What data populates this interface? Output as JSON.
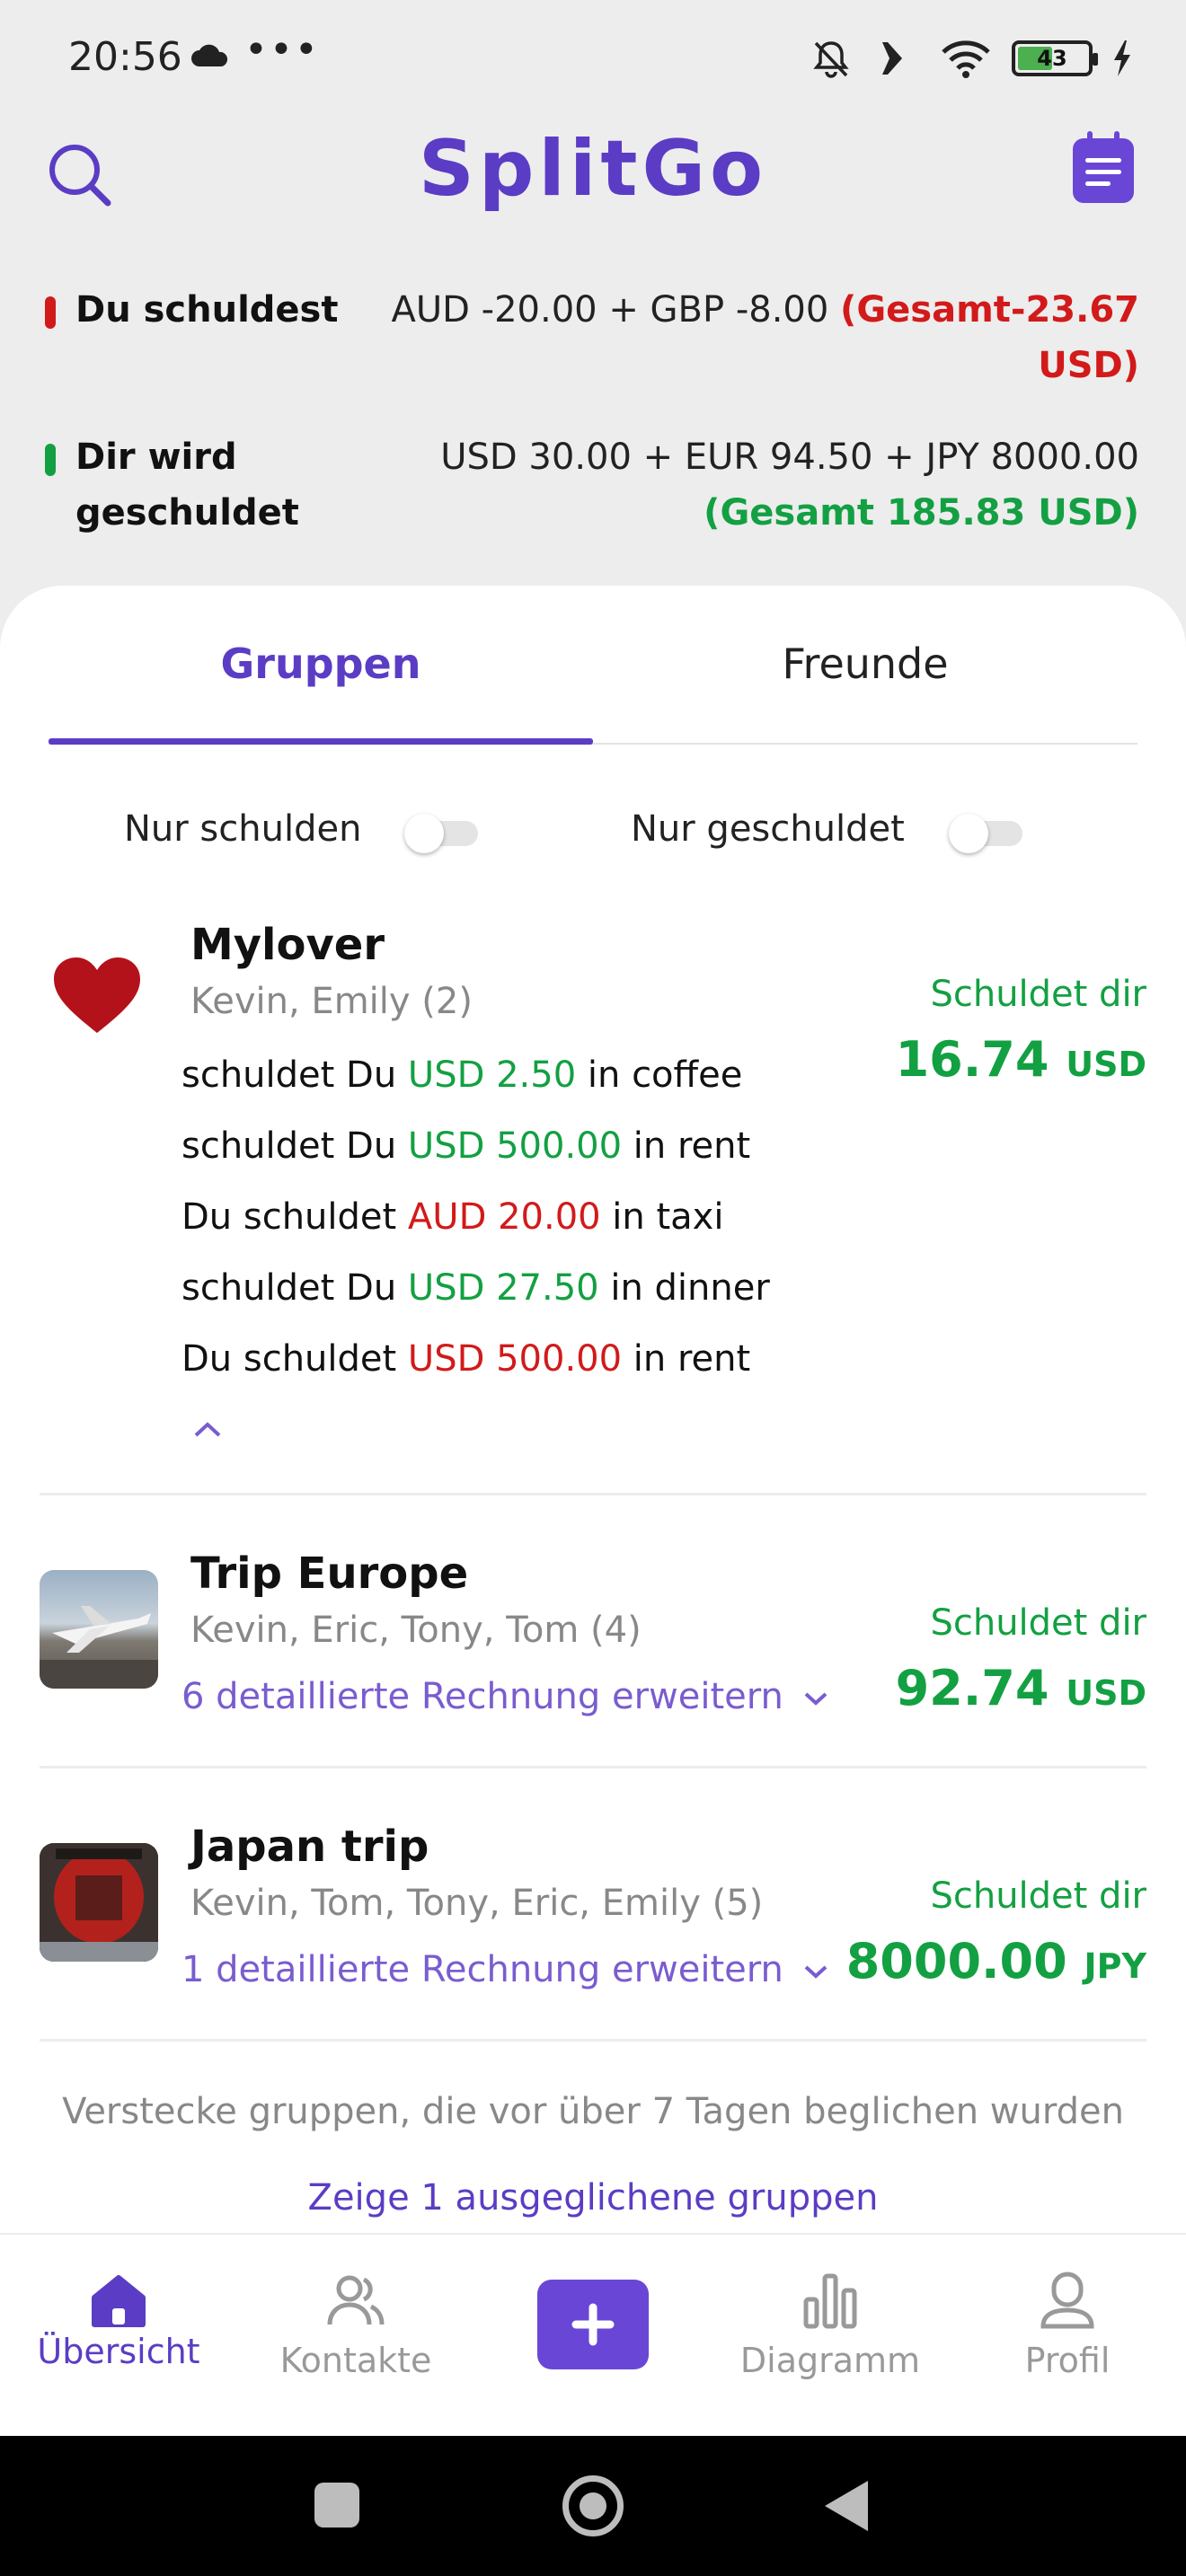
{
  "status_bar": {
    "time": "20:56",
    "dots": "•••",
    "battery": "43"
  },
  "header": {
    "title": "SplitGo"
  },
  "summary": {
    "owe": {
      "label": "Du schuldest",
      "amounts": "AUD -20.00 + GBP -8.00 ",
      "total_line1": "(Gesamt-23.67",
      "total_line2": "USD)"
    },
    "owed": {
      "label_line1": "Dir wird",
      "label_line2": "geschuldet",
      "amounts": "USD 30.00 + EUR 94.50 + JPY 8000.00",
      "total": "(Gesamt 185.83 USD)"
    }
  },
  "tabs": {
    "groups": "Gruppen",
    "friends": "Freunde"
  },
  "filters": {
    "only_owe": "Nur schulden",
    "only_owed": "Nur geschuldet"
  },
  "groups": [
    {
      "name": "Mylover",
      "members": "Kevin, Emily (2)",
      "status_label": "Schuldet dir",
      "amount": "16.74",
      "currency": "USD",
      "bills": [
        {
          "prefix": "schuldet Du ",
          "amount": "USD 2.50",
          "suffix": " in coffee",
          "color": "#13a042"
        },
        {
          "prefix": "schuldet Du ",
          "amount": "USD 500.00",
          "suffix": " in rent",
          "color": "#13a042"
        },
        {
          "prefix": "Du schuldet ",
          "amount": "AUD 20.00",
          "suffix": " in taxi",
          "color": "#d21a1a"
        },
        {
          "prefix": "schuldet Du ",
          "amount": "USD 27.50",
          "suffix": " in dinner",
          "color": "#13a042"
        },
        {
          "prefix": "Du schuldet ",
          "amount": "USD 500.00",
          "suffix": " in rent",
          "color": "#d21a1a"
        }
      ]
    },
    {
      "name": "Trip Europe",
      "members": "Kevin, Eric, Tony, Tom (4)",
      "expand": "6 detaillierte Rechnung erweitern",
      "status_label": "Schuldet dir",
      "amount": "92.74",
      "currency": "USD"
    },
    {
      "name": "Japan trip",
      "members": "Kevin, Tom, Tony, Eric, Emily (5)",
      "expand": "1 detaillierte Rechnung erweitern",
      "status_label": "Schuldet dir",
      "amount": "8000.00",
      "currency": "JPY"
    }
  ],
  "footer": {
    "hint": "Verstecke gruppen, die vor über 7 Tagen beglichen wurden",
    "show_settled": "Zeige 1 ausgeglichene gruppen"
  },
  "nav": {
    "overview": "Übersicht",
    "contacts": "Kontakte",
    "chart": "Diagramm",
    "profile": "Profil"
  },
  "colors": {
    "accent": "#5b3cc4",
    "positive": "#13a042",
    "negative": "#d21a1a"
  },
  "icons": [
    "search-icon",
    "calendar-icon",
    "heart-icon",
    "home-icon",
    "contacts-icon",
    "add-icon",
    "bar-chart-icon",
    "profile-icon"
  ]
}
